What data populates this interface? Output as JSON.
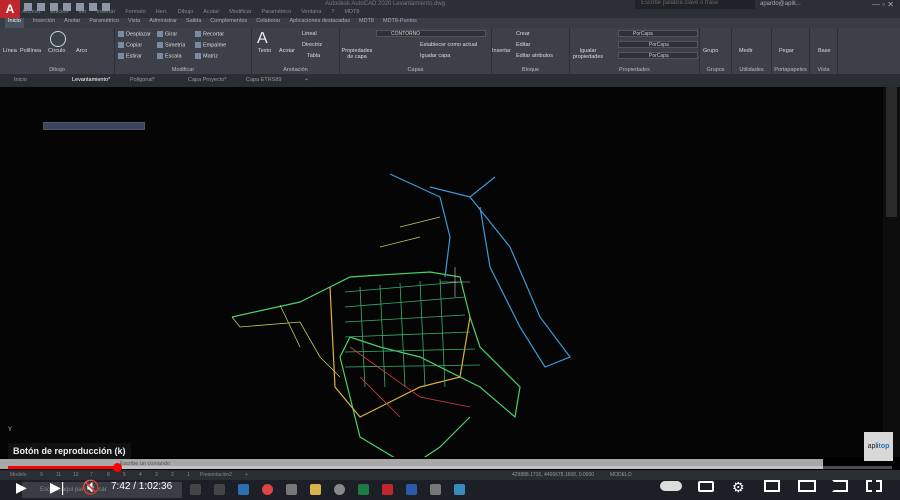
{
  "app": {
    "title": "Autodesk AutoCAD 2020   Levantamiento.dwg",
    "logo": "A",
    "search_placeholder": "Escribe palabra clave o frase",
    "user": "apardo@aplit..."
  },
  "menubar": [
    "Archivo",
    "Edición",
    "Ver",
    "Insertar",
    "Formato",
    "Herr.",
    "Dibujo",
    "Acotar",
    "Modificar",
    "Paramétrico",
    "Ventana",
    "?",
    "MDT8"
  ],
  "ribbon_tabs": [
    "Inicio",
    "Inserción",
    "Anotar",
    "Paramétrico",
    "Vista",
    "Administrar",
    "Salida",
    "Complementos",
    "Colaborar",
    "Aplicaciones destacadas",
    "MDT8",
    "MDT8-Puntos"
  ],
  "panels": {
    "dibujo": {
      "title": "Dibujo",
      "items": [
        "Línea",
        "Polilínea",
        "Círculo",
        "Arco"
      ]
    },
    "modificar": {
      "title": "Modificar",
      "items": [
        "Desplazar",
        "Girar",
        "Recortar",
        "Copiar",
        "Simetría",
        "Empalme",
        "Estirar",
        "Escala",
        "Matriz"
      ]
    },
    "anotacion": {
      "title": "Anotación",
      "items": [
        "Texto",
        "Acotar",
        "Lineal",
        "Directriz",
        "Tabla"
      ]
    },
    "capas": {
      "title": "Capas",
      "big": "Propiedades de capa",
      "layer": "CONTORNO",
      "items": [
        "Establecer como actual",
        "Igualar capa"
      ]
    },
    "bloque": {
      "title": "Bloque",
      "big": "Insertar",
      "items": [
        "Crear",
        "Editar",
        "Editar atributos"
      ]
    },
    "propiedades": {
      "title": "Propiedades",
      "big": "Igualar propiedades",
      "values": [
        "PorCapa",
        "PorCapa",
        "PorCapa"
      ]
    },
    "grupos": {
      "title": "Grupos",
      "big": "Grupo"
    },
    "utilidades": {
      "title": "Utilidades",
      "big": "Medir"
    },
    "portapapeles": {
      "title": "Portapapeles",
      "big": "Pegar"
    },
    "vista": {
      "title": "Vista",
      "big": "Base"
    }
  },
  "doc_tabs": [
    {
      "label": "Inicio"
    },
    {
      "label": "Levantamiento*",
      "active": true
    },
    {
      "label": "Poligonal*"
    },
    {
      "label": "Capa Proyecto*"
    },
    {
      "label": "Capa ETRS89"
    }
  ],
  "command_placeholder": "Escribe un comando",
  "layout_tabs": [
    "Modelo",
    "9",
    "11",
    "10",
    "7",
    "8",
    "5",
    "4",
    "3",
    "2",
    "1",
    "Presentación2",
    "+"
  ],
  "status": {
    "coords": "429888.1716, 4466678.1668, 0.0000",
    "mode": "MODELO"
  },
  "taskbar": {
    "search_placeholder": "Escribe aquí para buscar"
  },
  "player": {
    "tooltip": "Botón de reproducción (k)",
    "current_time": "7:42",
    "duration": "1:02:36",
    "time_text": "7:42 / 1:02:36",
    "progress_percent": 12.3,
    "accent": "#ff0000",
    "watermark": "aplitop",
    "muted": true,
    "autoplay": true
  },
  "axis_label": "Y"
}
